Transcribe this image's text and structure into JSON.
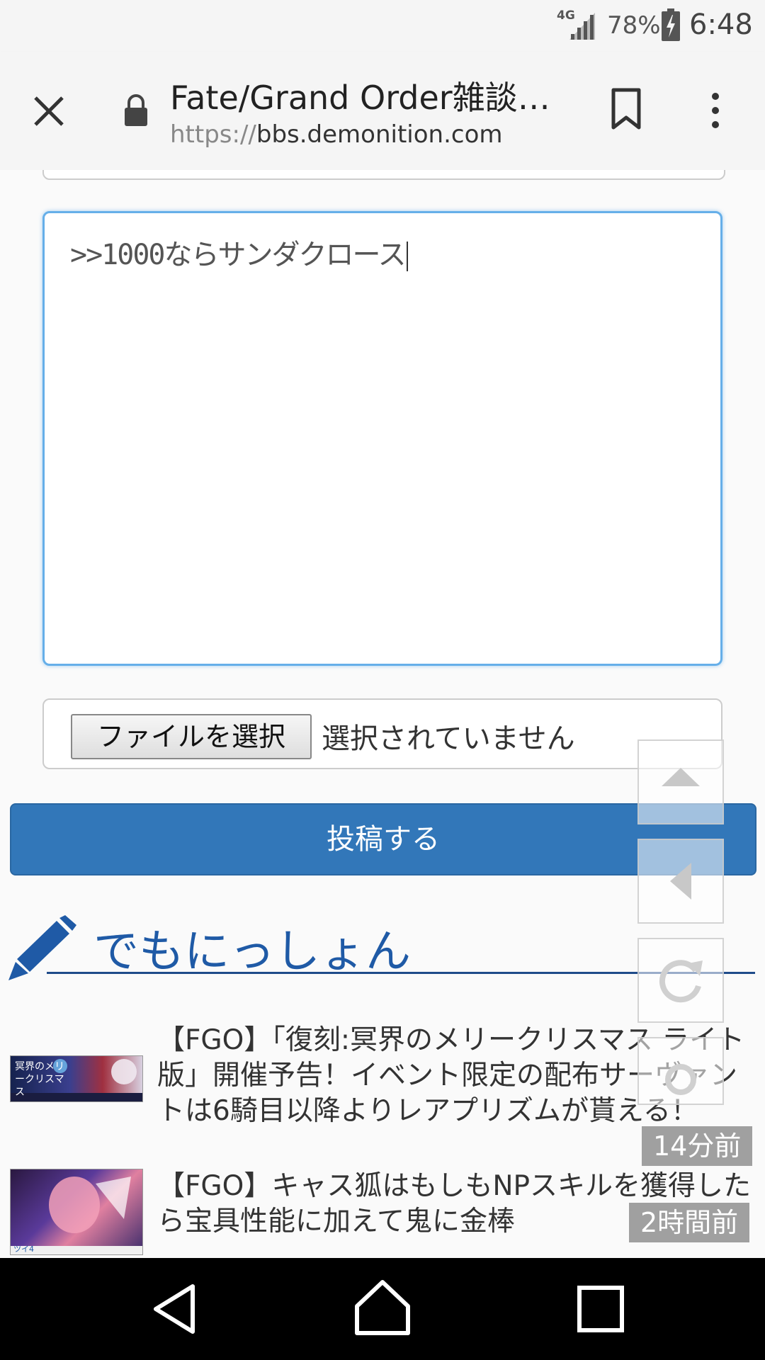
{
  "status_bar": {
    "network": "4G",
    "battery": "78%",
    "time": "6:48"
  },
  "toolbar": {
    "title": "Fate/Grand Order雑談ス…",
    "url_scheme": "https://",
    "url_host": "bbs.demonition.com"
  },
  "form": {
    "textarea_value": ">>1000ならサンダクロース",
    "file_button": "ファイルを選択",
    "file_status": "選択されていません",
    "submit_label": "投稿する"
  },
  "section": {
    "title": "でもにっしょん"
  },
  "news": [
    {
      "text": "【FGO】「復刻:冥界のメリークリスマス ライト版」開催予告！イベント限定の配布サーヴァントは6騎目以降よりレアプリズムが貰える！",
      "time": "14分前",
      "thumb_label": "冥界のメリークリスマス"
    },
    {
      "text": "【FGO】キャス狐はもしもNPスキルを獲得したら宝具性能に加えて鬼に金棒",
      "time": "2時間前",
      "thumb_label": "ツイ4"
    }
  ],
  "colors": {
    "accent": "#3277b9",
    "section_title": "#1f5aa6",
    "focus_border": "#66afe9"
  }
}
